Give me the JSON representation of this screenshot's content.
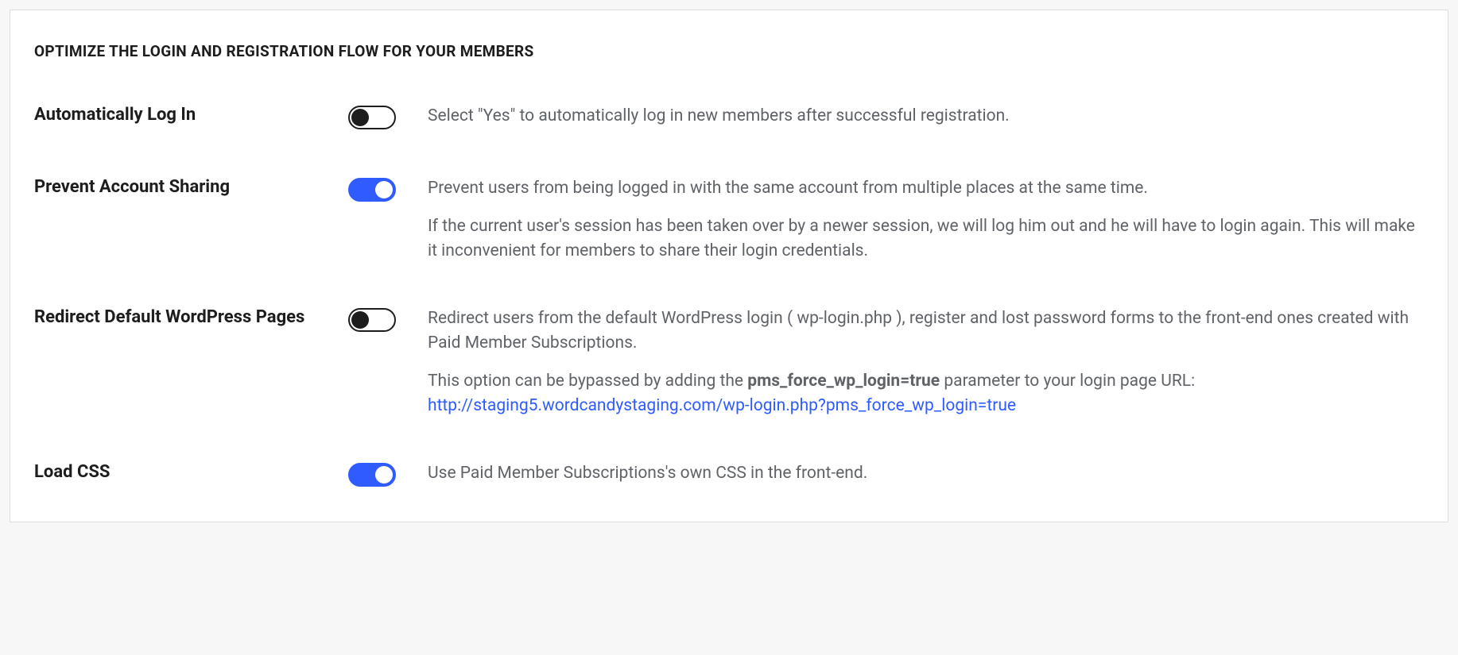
{
  "section_heading": "OPTIMIZE THE LOGIN AND REGISTRATION FLOW FOR YOUR MEMBERS",
  "settings": {
    "auto_login": {
      "label": "Automatically Log In",
      "on": false,
      "desc": "Select \"Yes\" to automatically log in new members after successful registration."
    },
    "prevent_sharing": {
      "label": "Prevent Account Sharing",
      "on": true,
      "desc1": "Prevent users from being logged in with the same account from multiple places at the same time.",
      "desc2": "If the current user's session has been taken over by a newer session, we will log him out and he will have to login again. This will make it inconvenient for members to share their login credentials."
    },
    "redirect_wp": {
      "label": "Redirect Default WordPress Pages",
      "on": false,
      "desc1": "Redirect users from the default WordPress login ( wp-login.php ), register and lost password forms to the front-end ones created with Paid Member Subscriptions.",
      "desc2_prefix": "This option can be bypassed by adding the ",
      "desc2_param": "pms_force_wp_login=true",
      "desc2_middle": " parameter to your login page URL: ",
      "desc2_link": "http://staging5.wordcandystaging.com/wp-login.php?pms_force_wp_login=true"
    },
    "load_css": {
      "label": "Load CSS",
      "on": true,
      "desc": "Use Paid Member Subscriptions's own CSS in the front-end."
    }
  }
}
